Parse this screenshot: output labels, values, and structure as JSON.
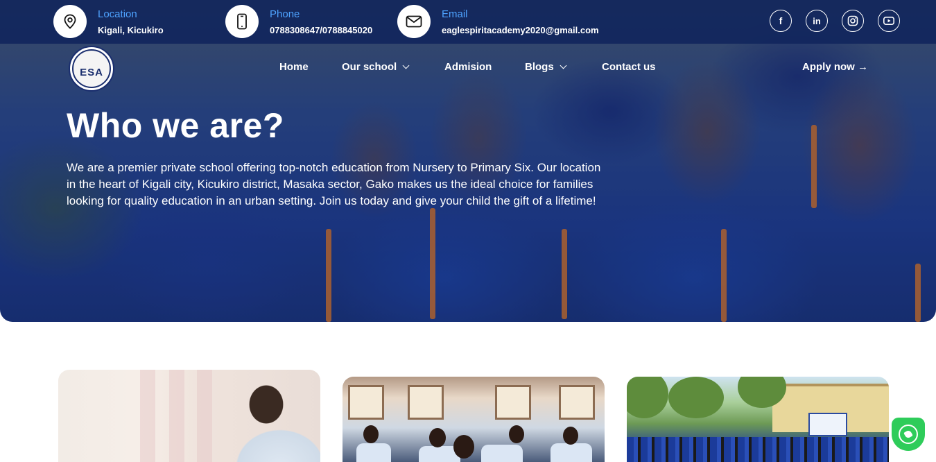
{
  "topbar": {
    "location": {
      "label": "Location",
      "value": "Kigali, Kicukiro",
      "icon": "location-pin-icon"
    },
    "phone": {
      "label": "Phone",
      "value": "0788308647/0788845020",
      "icon": "phone-icon"
    },
    "email": {
      "label": "Email",
      "value": "eaglespiritacademy2020@gmail.com",
      "icon": "mail-icon"
    },
    "socials": [
      {
        "name": "facebook-icon",
        "glyph": "f"
      },
      {
        "name": "linkedin-icon",
        "glyph": "in"
      },
      {
        "name": "instagram-icon",
        "glyph": "◎"
      },
      {
        "name": "youtube-icon",
        "glyph": "▶"
      }
    ]
  },
  "logo": {
    "abbr": "ESA"
  },
  "nav": {
    "home": "Home",
    "our_school": "Our school",
    "admission": "Admision",
    "blogs": "Blogs",
    "contact": "Contact us",
    "apply": "Apply now →"
  },
  "hero": {
    "title": "Who we are?",
    "description": "We are a premier private school offering top-notch education from Nursery to Primary Six. Our location in the heart of Kigali city, Kicukiro district, Masaka sector, Gako makes us the ideal choice for families looking for quality education in an urban setting. Join us today and give your child the gift of a lifetime!"
  },
  "colors": {
    "topbar": "#10245c",
    "accent": "#4ea3ff",
    "whatsapp": "#2ecc5a"
  }
}
